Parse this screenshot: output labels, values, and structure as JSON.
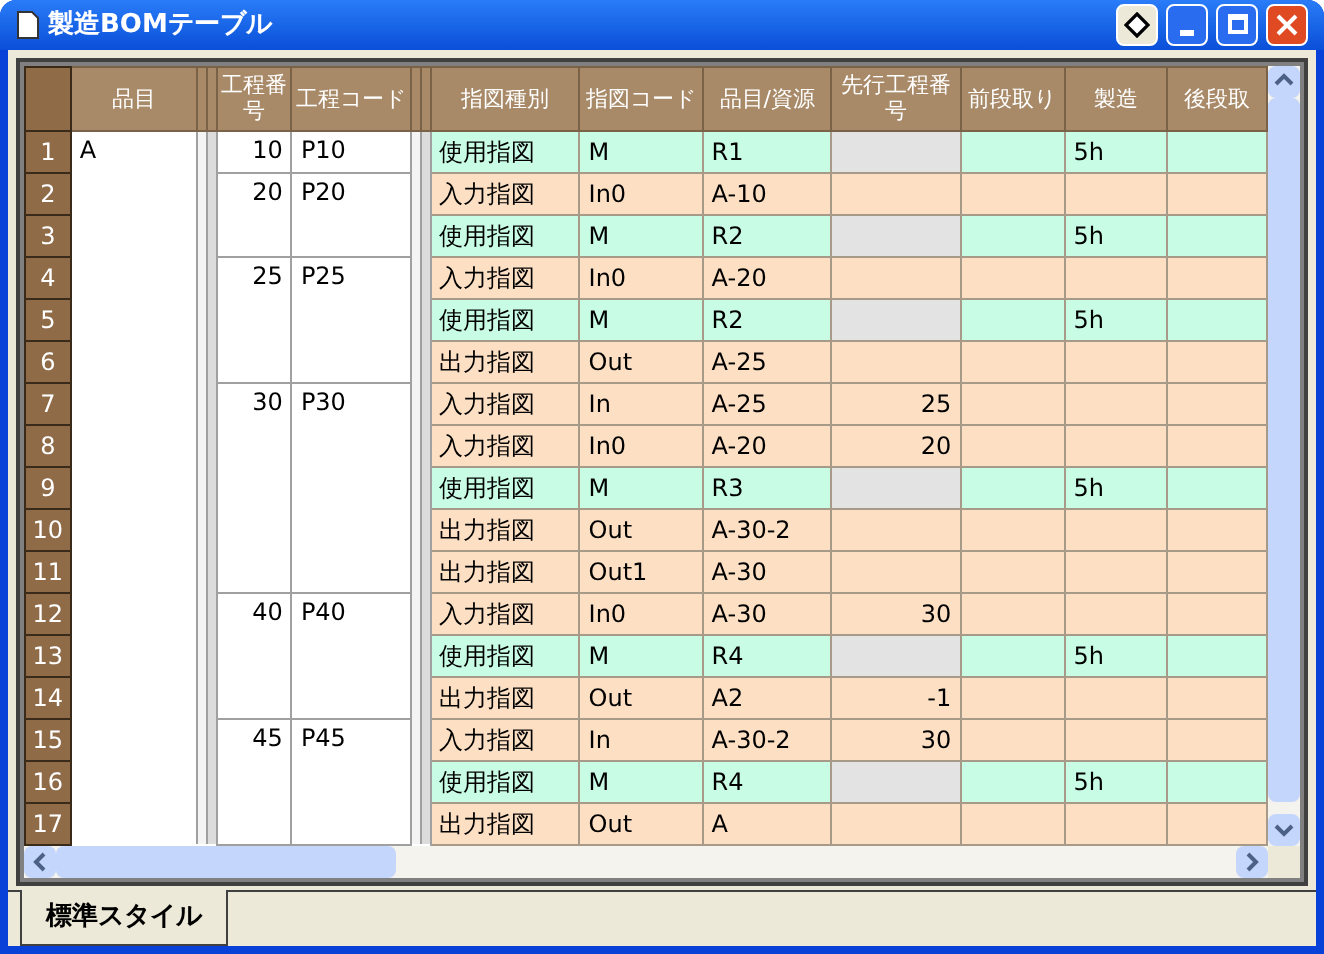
{
  "window": {
    "title": "製造BOMテーブル"
  },
  "table": {
    "columns": [
      "品目",
      "工程番号",
      "工程コード",
      "指図種別",
      "指図コード",
      "品目/資源",
      "先行工程番号",
      "前段取り",
      "製造",
      "後段取"
    ],
    "items": [
      {
        "name": "A",
        "processes": [
          {
            "no": "10",
            "code": "P10",
            "orders": [
              {
                "row": "1",
                "kind": "usage",
                "type": "使用指図",
                "code": "M",
                "resource": "R1",
                "manufacture": "5h"
              }
            ]
          },
          {
            "no": "20",
            "code": "P20",
            "orders": [
              {
                "row": "2",
                "kind": "io",
                "type": "入力指図",
                "code": "In0",
                "resource": "A-10"
              },
              {
                "row": "3",
                "kind": "usage",
                "type": "使用指図",
                "code": "M",
                "resource": "R2",
                "manufacture": "5h"
              }
            ]
          },
          {
            "no": "25",
            "code": "P25",
            "orders": [
              {
                "row": "4",
                "kind": "io",
                "type": "入力指図",
                "code": "In0",
                "resource": "A-20"
              },
              {
                "row": "5",
                "kind": "usage",
                "type": "使用指図",
                "code": "M",
                "resource": "R2",
                "manufacture": "5h"
              },
              {
                "row": "6",
                "kind": "io",
                "type": "出力指図",
                "code": "Out",
                "resource": "A-25"
              }
            ]
          },
          {
            "no": "30",
            "code": "P30",
            "orders": [
              {
                "row": "7",
                "kind": "io",
                "type": "入力指図",
                "code": "In",
                "resource": "A-25",
                "prev": "25"
              },
              {
                "row": "8",
                "kind": "io",
                "type": "入力指図",
                "code": "In0",
                "resource": "A-20",
                "prev": "20"
              },
              {
                "row": "9",
                "kind": "usage",
                "type": "使用指図",
                "code": "M",
                "resource": "R3",
                "manufacture": "5h"
              },
              {
                "row": "10",
                "kind": "io",
                "type": "出力指図",
                "code": "Out",
                "resource": "A-30-2"
              },
              {
                "row": "11",
                "kind": "io",
                "type": "出力指図",
                "code": "Out1",
                "resource": "A-30"
              }
            ]
          },
          {
            "no": "40",
            "code": "P40",
            "orders": [
              {
                "row": "12",
                "kind": "io",
                "type": "入力指図",
                "code": "In0",
                "resource": "A-30",
                "prev": "30"
              },
              {
                "row": "13",
                "kind": "usage",
                "type": "使用指図",
                "code": "M",
                "resource": "R4",
                "manufacture": "5h"
              },
              {
                "row": "14",
                "kind": "io",
                "type": "出力指図",
                "code": "Out",
                "resource": "A2",
                "prev": "-1"
              }
            ]
          },
          {
            "no": "45",
            "code": "P45",
            "orders": [
              {
                "row": "15",
                "kind": "io",
                "type": "入力指図",
                "code": "In",
                "resource": "A-30-2",
                "prev": "30"
              },
              {
                "row": "16",
                "kind": "usage",
                "type": "使用指図",
                "code": "M",
                "resource": "R4",
                "manufacture": "5h"
              },
              {
                "row": "17",
                "kind": "io",
                "type": "出力指図",
                "code": "Out",
                "resource": "A"
              }
            ]
          }
        ]
      }
    ]
  },
  "tabs": [
    {
      "label": "標準スタイル",
      "selected": true
    }
  ]
}
